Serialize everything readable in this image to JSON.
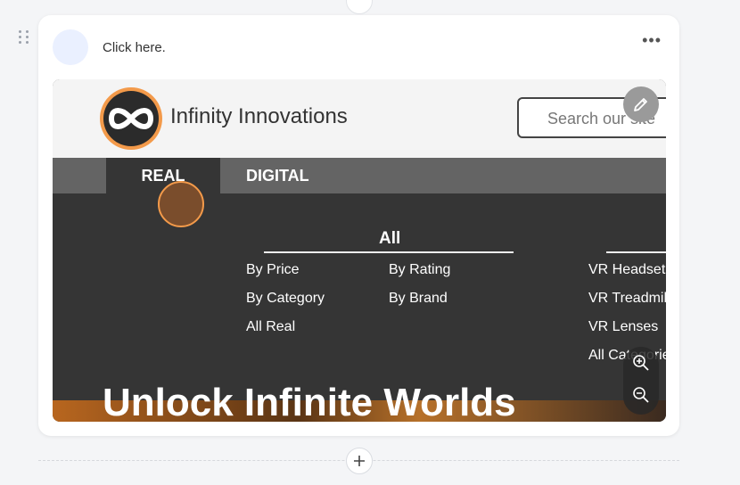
{
  "step": {
    "instruction": "Click here."
  },
  "site": {
    "brand_name": "Infinity Innovations",
    "search_placeholder": "Search our site",
    "nav": {
      "real_label": "REAL",
      "digital_label": "DIGITAL"
    },
    "mega_menu": {
      "title": "All",
      "column1": [
        "By Price",
        "By Category",
        "All Real"
      ],
      "column2": [
        "By Rating",
        "By Brand"
      ],
      "column3": [
        "VR Headset",
        "VR Treadmill",
        "VR Lenses",
        "All Categories"
      ]
    },
    "hero_text": "Unlock Infinite Worlds"
  },
  "icons": {
    "drag": "drag-handle-icon",
    "more": "more-options-icon",
    "edit": "pencil-icon",
    "zoom_in": "zoom-in-icon",
    "zoom_out": "zoom-out-icon",
    "add": "plus-icon"
  },
  "colors": {
    "accent_orange": "#f39a4a",
    "nav_dark": "#353535",
    "nav_bar": "#646464"
  }
}
